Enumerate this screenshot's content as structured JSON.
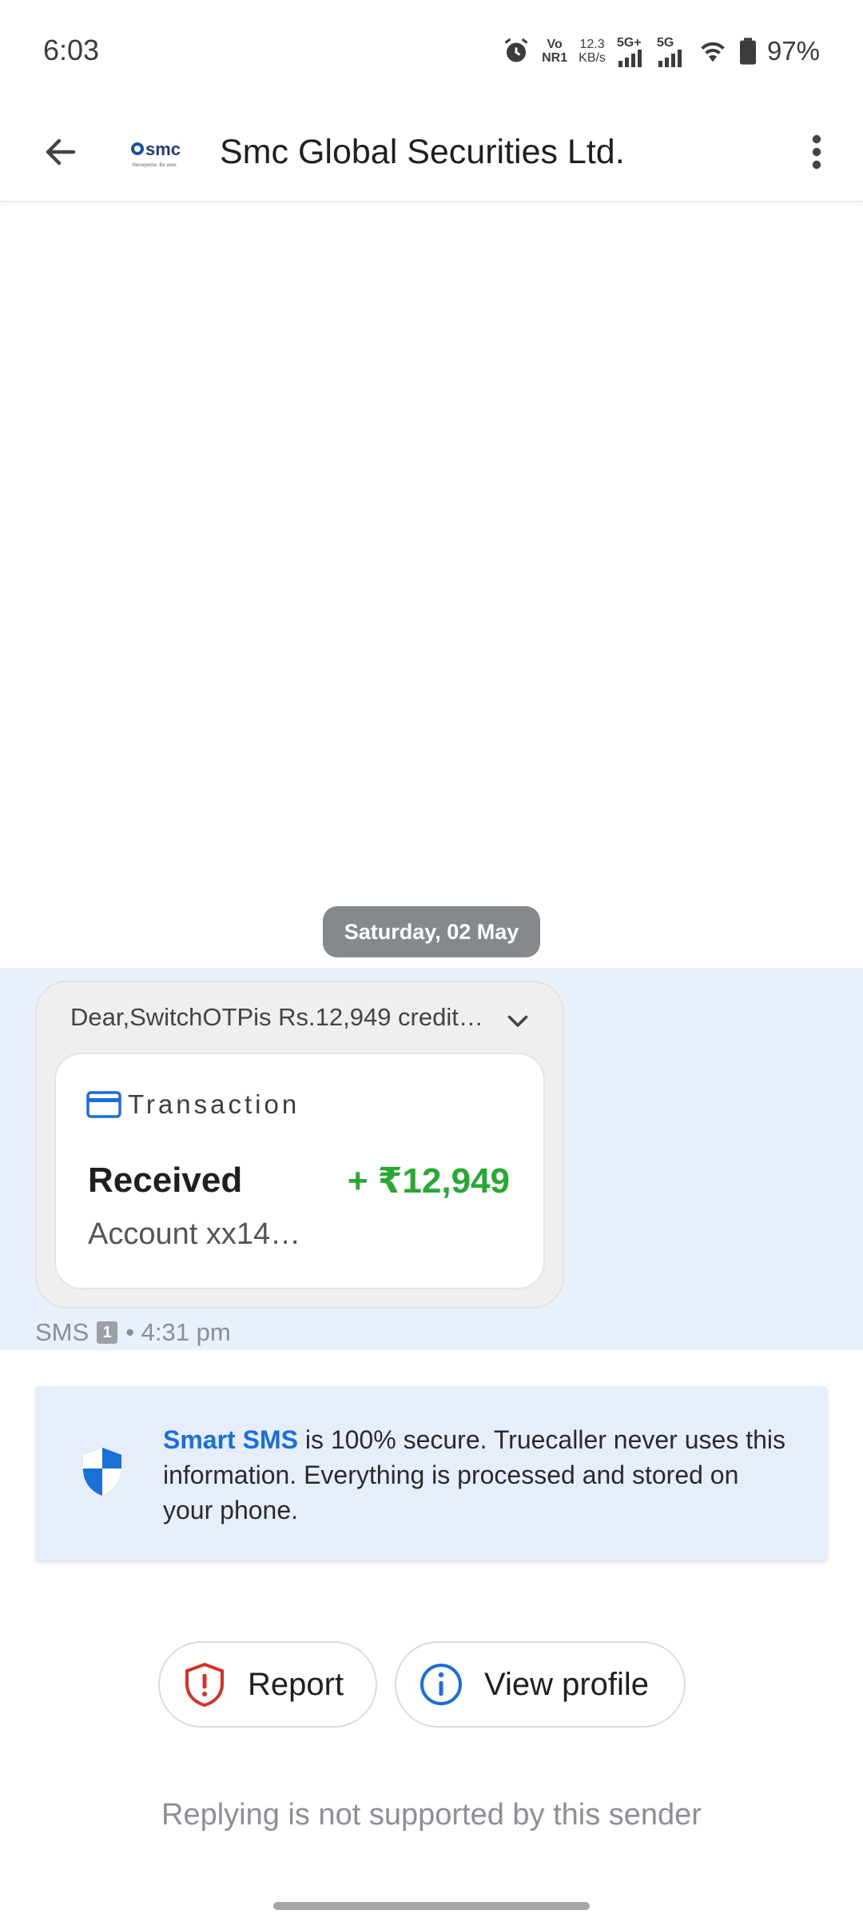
{
  "status_bar": {
    "time": "6:03",
    "network_volte": "Vo",
    "network_nr": "NR1",
    "speed_value": "12.3",
    "speed_unit": "KB/s",
    "sim1_label": "5G+",
    "sim2_label": "5G",
    "battery_percent": "97%"
  },
  "header": {
    "title": "Smc Global Securities Ltd.",
    "logo_text": "smc",
    "logo_tagline": "Moneywise. Be wise."
  },
  "conversation": {
    "date_chip": "Saturday, 02 May",
    "message_preview": "Dear,SwitchOTPis Rs.12,949 credit…",
    "card": {
      "label": "Transaction",
      "status": "Received",
      "amount": "+ ₹12,949",
      "account": "Account xx14…"
    },
    "meta_type": "SMS",
    "meta_sim": "1",
    "meta_time": "• 4:31 pm"
  },
  "info_banner": {
    "brand": "Smart SMS",
    "text": " is 100% secure. Truecaller never uses this information. Everything is processed and stored on your phone."
  },
  "actions": {
    "report_label": "Report",
    "profile_label": "View profile"
  },
  "footer_note": "Replying is not supported by this sender",
  "colors": {
    "accent_blue": "#1a6fd8",
    "amount_green": "#2aa834",
    "report_red": "#d93025",
    "highlight_bg": "#e8f0fb"
  }
}
